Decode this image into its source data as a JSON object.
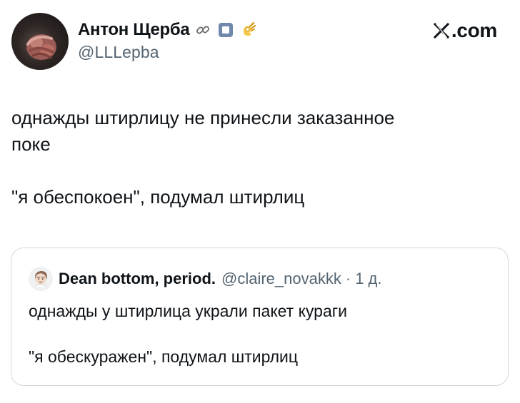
{
  "header": {
    "author_name": "Антон Щерба",
    "author_handle": "@LLLepba",
    "brand_text": ".com",
    "badge_icons": [
      "link-icon",
      "square-stop-icon",
      "ok-hand-icon"
    ]
  },
  "tweet": {
    "line1": "однажды штирлицу не принесли заказанное",
    "line2": "поке",
    "line3": "\"я обеспокоен\", подумал штирлиц"
  },
  "quote": {
    "author_name": "Dean bottom, period.",
    "author_handle": "@claire_novakkk",
    "separator": "·",
    "timestamp": "1 д.",
    "line1": "однажды у штирлица украли пакет кураги",
    "line2": "\"я обескуражен\", подумал штирлиц"
  },
  "colors": {
    "text_primary": "#0f1419",
    "text_secondary": "#536471",
    "border": "#cfd9de"
  }
}
